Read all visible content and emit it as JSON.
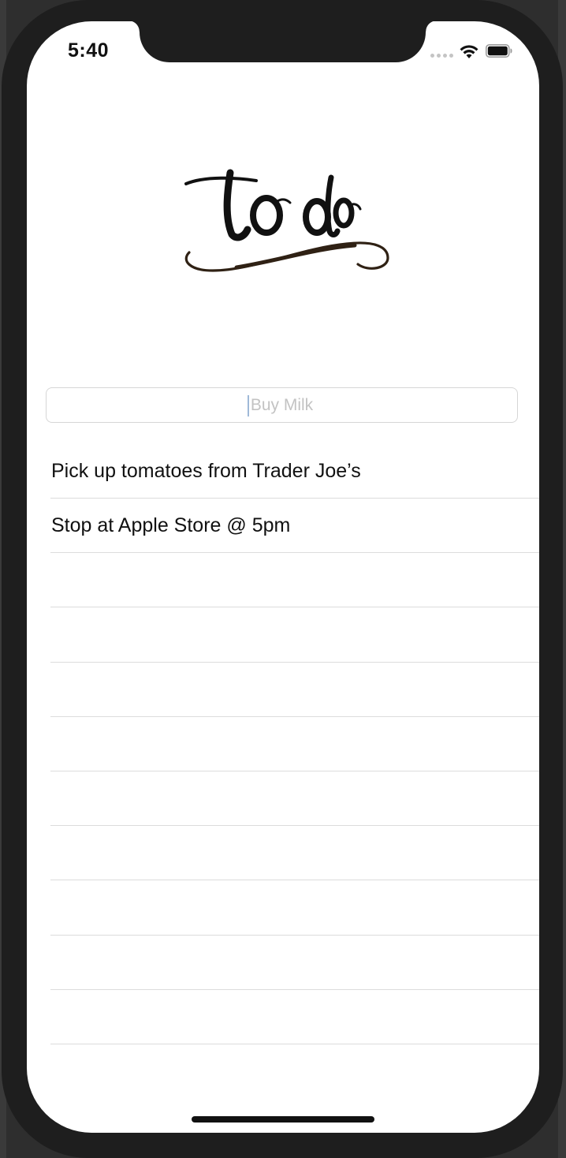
{
  "status_bar": {
    "time": "5:40"
  },
  "logo": {
    "alt_text": "to do"
  },
  "new_item_input": {
    "placeholder": "Buy Milk",
    "value": ""
  },
  "todo_list": {
    "items": [
      {
        "label": "Pick up tomatoes from Trader Joe’s"
      },
      {
        "label": "Stop at Apple Store @ 5pm"
      },
      {
        "label": ""
      },
      {
        "label": ""
      },
      {
        "label": ""
      },
      {
        "label": ""
      },
      {
        "label": ""
      },
      {
        "label": ""
      },
      {
        "label": ""
      },
      {
        "label": ""
      },
      {
        "label": ""
      }
    ]
  },
  "icons": {
    "signal": "cellular-signal-icon",
    "wifi": "wifi-icon",
    "battery": "battery-icon"
  },
  "colors": {
    "text": "#111111",
    "placeholder": "#c3c3c3",
    "separator": "#dcdcdc",
    "device_frame": "#1e1e1e",
    "logo_underline": "#3a2a18"
  }
}
